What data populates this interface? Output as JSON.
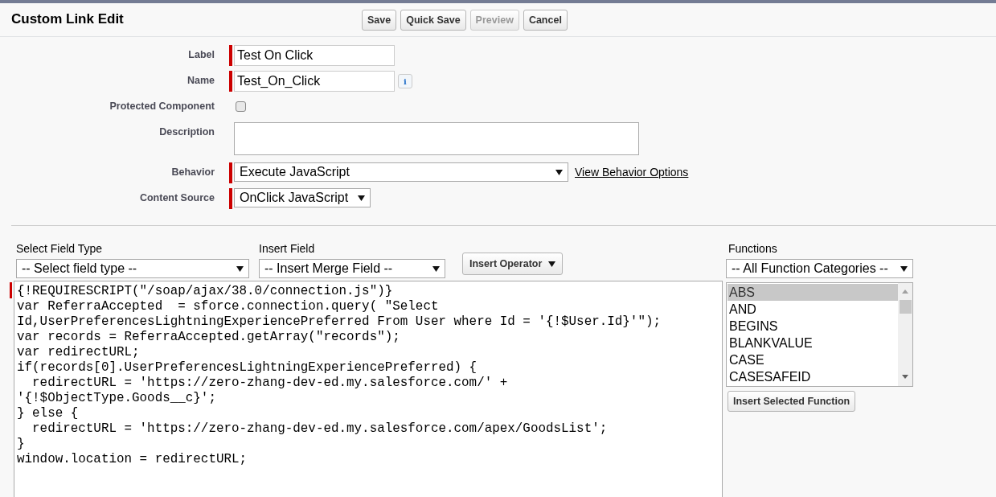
{
  "header": {
    "title": "Custom Link Edit",
    "buttons": [
      {
        "label": "Save",
        "disabled": false
      },
      {
        "label": "Quick Save",
        "disabled": false
      },
      {
        "label": "Preview",
        "disabled": true
      },
      {
        "label": "Cancel",
        "disabled": false
      }
    ]
  },
  "form": [
    {
      "kind": "text",
      "label": "Label",
      "value": "Test On Click",
      "required": true
    },
    {
      "kind": "text",
      "label": "Name",
      "value": "Test_On_Click",
      "required": true,
      "info": "i"
    },
    {
      "kind": "checkbox",
      "label": "Protected Component",
      "checked": false
    },
    {
      "kind": "textarea",
      "label": "Description"
    },
    {
      "kind": "select",
      "label": "Behavior",
      "value": "Execute JavaScript",
      "required": true,
      "link": "View Behavior Options"
    },
    {
      "kind": "select",
      "label": "Content Source",
      "value": "OnClick JavaScript",
      "required": true
    }
  ],
  "editor": {
    "field_type": {
      "label": "Select Field Type",
      "value": "-- Select field type --"
    },
    "insert_field": {
      "label": "Insert Field",
      "value": "-- Insert Merge Field --"
    },
    "operator_button": "Insert Operator",
    "code_required": true,
    "code_lines": [
      "{!REQUIRESCRIPT(\"/soap/ajax/38.0/connection.js\")}",
      "var ReferraAccepted  = sforce.connection.query( \"Select",
      "Id,UserPreferencesLightningExperiencePreferred From User where Id = '{!$User.Id}'\");",
      "var records = ReferraAccepted.getArray(\"records\");",
      "var redirectURL;",
      "if(records[0].UserPreferencesLightningExperiencePreferred) {",
      "  redirectURL = 'https://zero-zhang-dev-ed.my.salesforce.com/' +",
      "'{!$ObjectType.Goods__c}';",
      "} else {",
      "  redirectURL = 'https://zero-zhang-dev-ed.my.salesforce.com/apex/GoodsList';",
      "}",
      "window.location = redirectURL;"
    ]
  },
  "functions": {
    "label": "Functions",
    "category": "-- All Function Categories --",
    "items": [
      {
        "name": "ABS",
        "selected": true
      },
      {
        "name": "AND",
        "selected": false
      },
      {
        "name": "BEGINS",
        "selected": false
      },
      {
        "name": "BLANKVALUE",
        "selected": false
      },
      {
        "name": "CASE",
        "selected": false
      },
      {
        "name": "CASESAFEID",
        "selected": false
      }
    ],
    "insert_button": "Insert Selected Function"
  }
}
